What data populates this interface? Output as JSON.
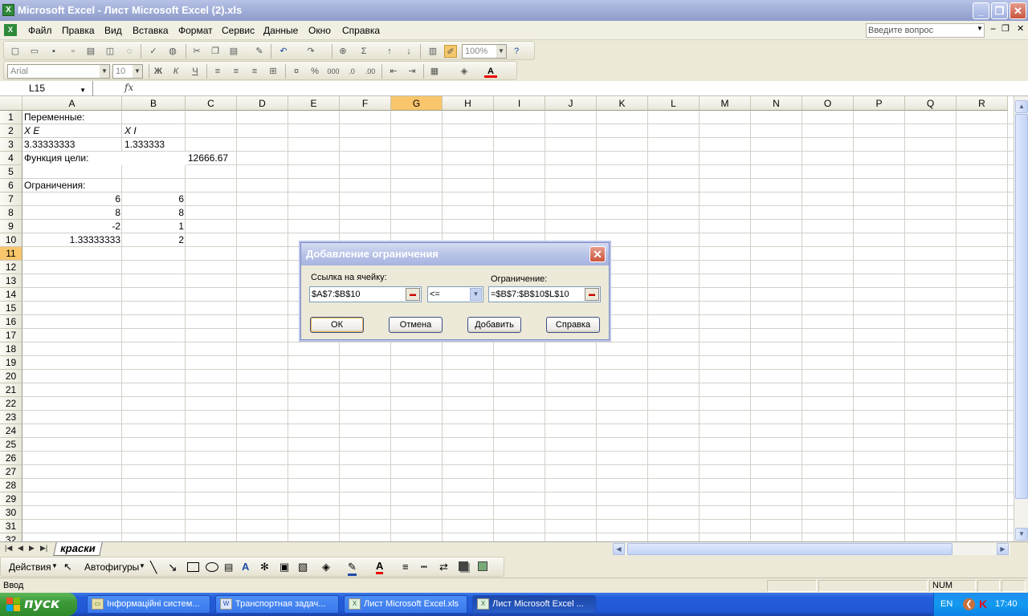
{
  "window": {
    "title": "Microsoft Excel - Лист Microsoft Excel (2).xls",
    "app_icon": "excel-icon",
    "minimize": "_",
    "restore": "❐",
    "close": "✕"
  },
  "menu": {
    "items": [
      "Файл",
      "Правка",
      "Вид",
      "Вставка",
      "Формат",
      "Сервис",
      "Данные",
      "Окно",
      "Справка"
    ],
    "ask_placeholder": "Введите вопрос",
    "doc_controls": [
      "−",
      "❐",
      "✕"
    ]
  },
  "toolbar": {
    "zoom": "100%",
    "font_name": "Arial",
    "font_size": "10"
  },
  "formula_bar": {
    "name_box": "L15",
    "fx": "fx",
    "formula": ""
  },
  "sheet": {
    "columns": [
      "A",
      "B",
      "C",
      "D",
      "E",
      "F",
      "G",
      "H",
      "I",
      "J",
      "K",
      "L",
      "M",
      "N",
      "O",
      "P",
      "Q",
      "R"
    ],
    "selected_column": "G",
    "rows": [
      "1",
      "2",
      "3",
      "4",
      "5",
      "6",
      "7",
      "8",
      "9",
      "10",
      "11",
      "12",
      "13",
      "14",
      "15",
      "16",
      "17",
      "18",
      "19",
      "20",
      "21",
      "22",
      "23",
      "24",
      "25",
      "26",
      "27",
      "28",
      "29",
      "30",
      "31",
      "32"
    ],
    "selected_row": "11",
    "cells": {
      "A1": "Переменные:",
      "A2": "X E",
      "B2": "X I",
      "A3": "3.33333333",
      "B3": "1.333333",
      "A4": "Функция цели:",
      "C4": "12666.67",
      "A6": "Ограничения:",
      "A7": "6",
      "B7": "6",
      "A8": "8",
      "B8": "8",
      "A9": "-2",
      "B9": "1",
      "A10": "1.33333333",
      "B10": "2"
    },
    "tab_name": "краски"
  },
  "drawing_toolbar": {
    "actions": "Действия",
    "autoshapes": "Автофигуры"
  },
  "status": {
    "mode": "Ввод",
    "num": "NUM"
  },
  "dialog": {
    "title": "Добавление ограничения",
    "cell_ref_label": "Ссылка на ячейку:",
    "cell_ref_value": "$A$7:$B$10",
    "operator": "<=",
    "constraint_label": "Ограничение:",
    "constraint_value": "=$B$7:$B$10$L$10",
    "buttons": {
      "ok": "ОК",
      "cancel": "Отмена",
      "add": "Добавить",
      "help": "Справка"
    }
  },
  "taskbar": {
    "start": "пуск",
    "items": [
      "Інформаційні систем...",
      "Транспортная задач...",
      "Лист Microsoft Excel.xls",
      "Лист Microsoft Excel ..."
    ],
    "lang": "EN",
    "clock": "17:40"
  }
}
